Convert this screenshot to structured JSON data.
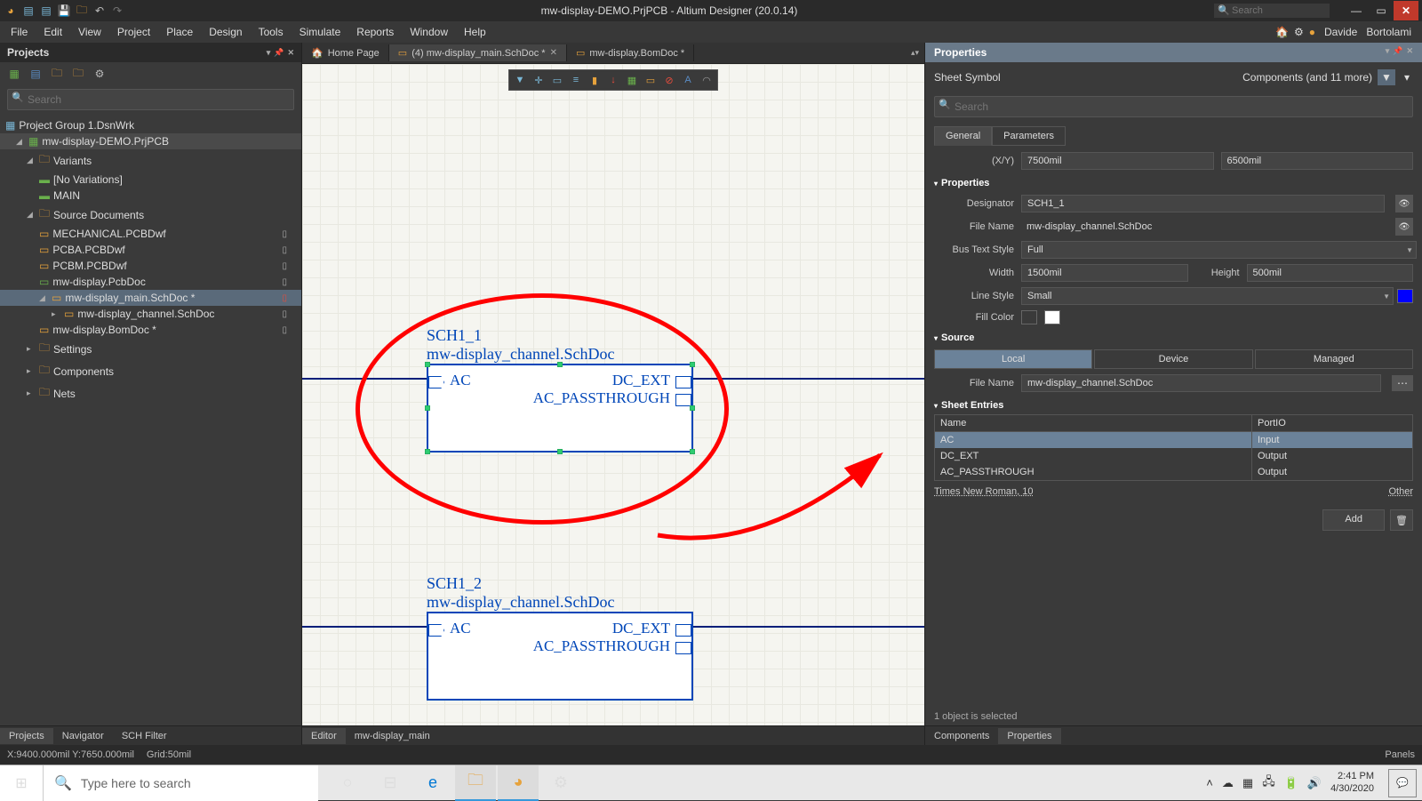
{
  "titlebar": {
    "title": "mw-display-DEMO.PrjPCB - Altium Designer (20.0.14)",
    "search_placeholder": "Search"
  },
  "menubar": {
    "items": [
      "File",
      "Edit",
      "View",
      "Project",
      "Place",
      "Design",
      "Tools",
      "Simulate",
      "Reports",
      "Window",
      "Help"
    ],
    "user_first": "Davide",
    "user_last": "Bortolami"
  },
  "projects": {
    "header": "Projects",
    "search_placeholder": "Search",
    "group": "Project Group 1.DsnWrk",
    "project": "mw-display-DEMO.PrjPCB",
    "variants_folder": "Variants",
    "no_variations": "[No Variations]",
    "main_variant": "MAIN",
    "source_docs": "Source Documents",
    "files": [
      {
        "name": "MECHANICAL.PCBDwf",
        "flag": "▯"
      },
      {
        "name": "PCBA.PCBDwf",
        "flag": "▯"
      },
      {
        "name": "PCBM.PCBDwf",
        "flag": "▯"
      },
      {
        "name": "mw-display.PcbDoc",
        "flag": "▯"
      },
      {
        "name": "mw-display_main.SchDoc *",
        "flag": "▯",
        "selected": true,
        "red": true
      },
      {
        "name": "mw-display_channel.SchDoc",
        "flag": "▯",
        "child": true
      },
      {
        "name": "mw-display.BomDoc *",
        "flag": "▯"
      }
    ],
    "folders": [
      "Settings",
      "Components",
      "Nets"
    ]
  },
  "tabs": {
    "home": "Home Page",
    "tab1": "(4) mw-display_main.SchDoc *",
    "tab2": "mw-display.BomDoc *"
  },
  "schematic": {
    "sym1": {
      "designator": "SCH1_1",
      "file": "mw-display_channel.SchDoc",
      "port_in": "AC",
      "port_out1": "DC_EXT",
      "port_out2": "AC_PASSTHROUGH"
    },
    "sym2": {
      "designator": "SCH1_2",
      "file": "mw-display_channel.SchDoc",
      "port_in": "AC",
      "port_out1": "DC_EXT",
      "port_out2": "AC_PASSTHROUGH"
    }
  },
  "properties": {
    "header": "Properties",
    "object_type": "Sheet Symbol",
    "scope": "Components (and 11 more)",
    "search_placeholder": "Search",
    "tab_general": "General",
    "tab_parameters": "Parameters",
    "xy_label": "(X/Y)",
    "x": "7500mil",
    "y": "6500mil",
    "sec_properties": "Properties",
    "designator_label": "Designator",
    "designator": "SCH1_1",
    "filename_label": "File Name",
    "filename": "mw-display_channel.SchDoc",
    "bustext_label": "Bus Text Style",
    "bustext": "Full",
    "width_label": "Width",
    "width": "1500mil",
    "height_label": "Height",
    "height": "500mil",
    "linestyle_label": "Line Style",
    "linestyle": "Small",
    "fillcolor_label": "Fill Color",
    "sec_source": "Source",
    "source_local": "Local",
    "source_device": "Device",
    "source_managed": "Managed",
    "src_filename_label": "File Name",
    "src_filename": "mw-display_channel.SchDoc",
    "sec_entries": "Sheet Entries",
    "col_name": "Name",
    "col_io": "PortIO",
    "entries": [
      {
        "name": "AC",
        "io": "Input",
        "selected": true
      },
      {
        "name": "DC_EXT",
        "io": "Output"
      },
      {
        "name": "AC_PASSTHROUGH",
        "io": "Output"
      }
    ],
    "font": "Times New Roman, 10",
    "other": "Other",
    "add": "Add",
    "selection_note": "1 object is selected"
  },
  "bottom_tabs_left": {
    "projects": "Projects",
    "navigator": "Navigator",
    "filter": "SCH Filter"
  },
  "bottom_tabs_center": {
    "editor": "Editor",
    "docname": "mw-display_main"
  },
  "bottom_tabs_right": {
    "components": "Components",
    "properties": "Properties"
  },
  "statusbar": {
    "coords": "X:9400.000mil Y:7650.000mil",
    "grid": "Grid:50mil",
    "panels": "Panels"
  },
  "taskbar": {
    "cortana": "Type here to search",
    "time": "2:41 PM",
    "date": "4/30/2020"
  }
}
